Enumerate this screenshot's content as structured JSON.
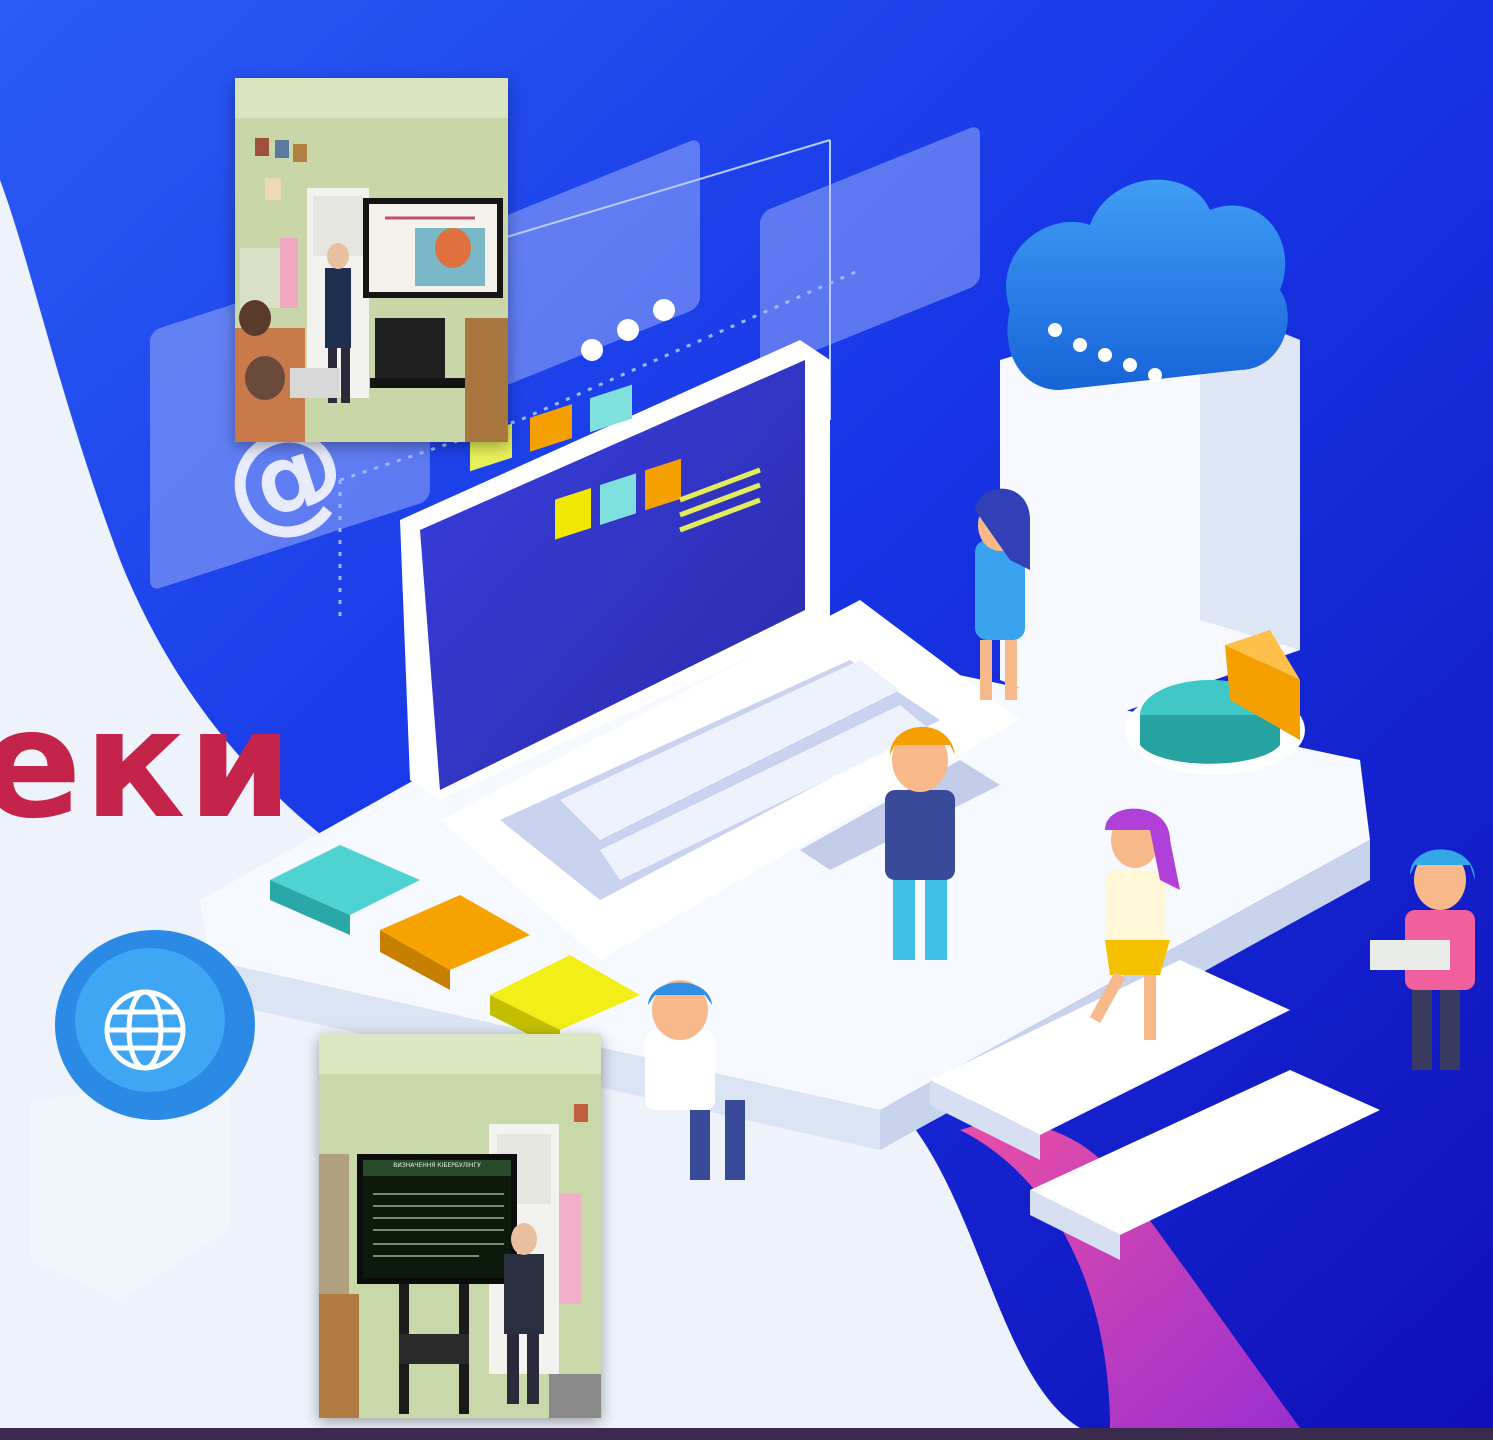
{
  "heading": {
    "text": "еки"
  },
  "photos": {
    "top": {
      "screen_title": ""
    },
    "bottom": {
      "screen_title": "ВИЗНАЧЕННЯ КІБЕРБУЛІНГУ"
    }
  },
  "icons": [
    "at-sign-icon",
    "globe-icon",
    "cloud-icon",
    "laptop-icon",
    "pie-chart-icon"
  ],
  "colors": {
    "heading": "#c4234a",
    "blue_dark": "#0d24c9",
    "blue_mid": "#1f45f0",
    "white_blob": "#eef3fb",
    "teal": "#46c9c9",
    "orange": "#f5a000",
    "yellow": "#f0e800",
    "pink": "#d63da0",
    "bottom_bar": "#3a2b4e"
  }
}
